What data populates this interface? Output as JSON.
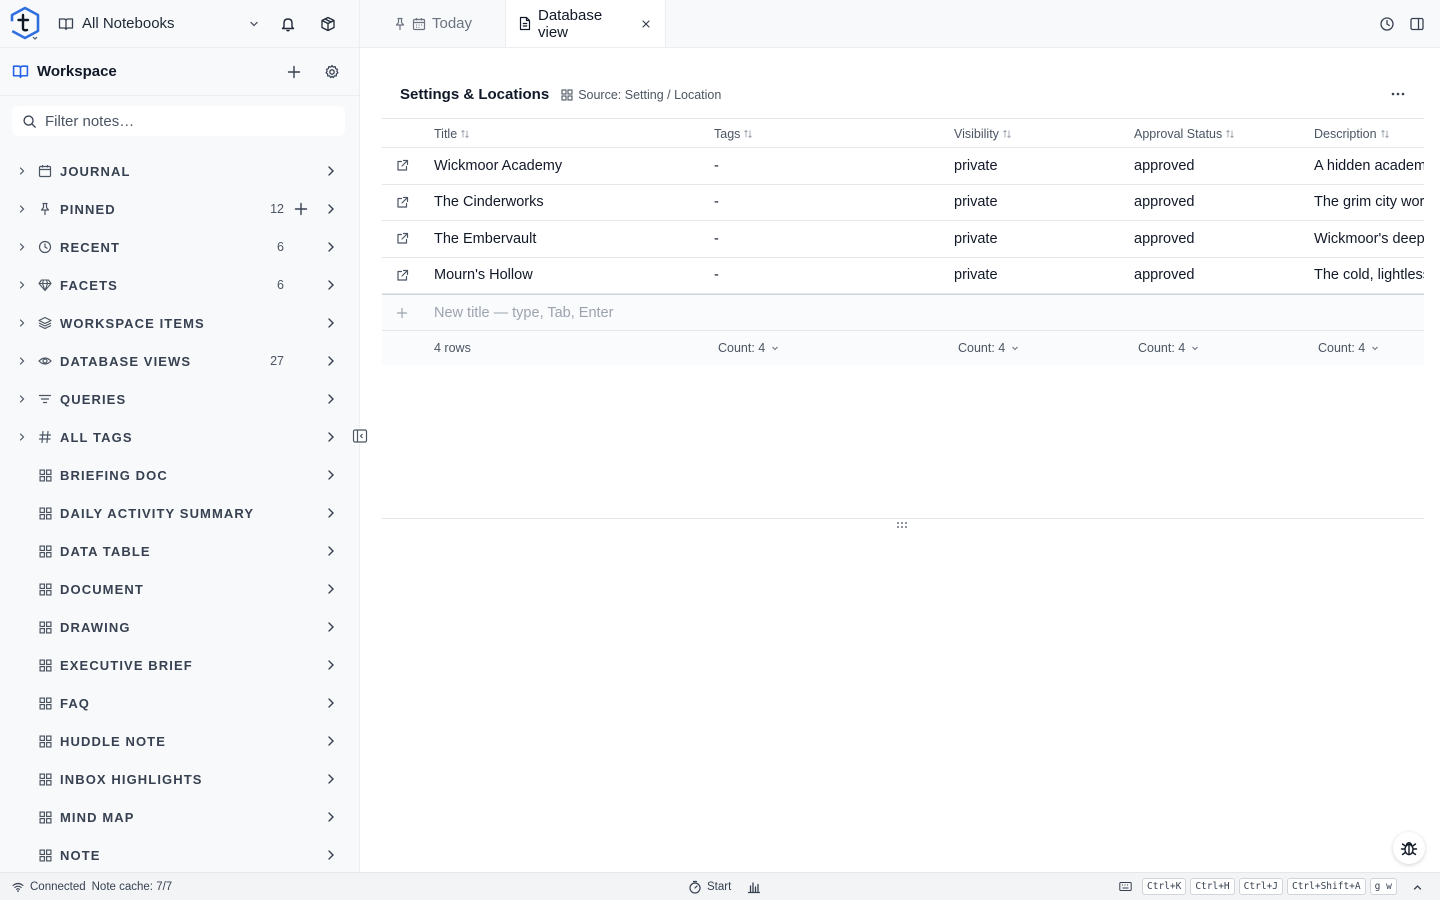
{
  "sidebar": {
    "notebook_select": "All Notebooks",
    "workspace_title": "Workspace",
    "filter_placeholder": "Filter notes…",
    "sections": [
      {
        "label": "JOURNAL",
        "icon": "calendar-icon",
        "count": "",
        "expandable": true,
        "plus": false
      },
      {
        "label": "PINNED",
        "icon": "pin-icon",
        "count": "12",
        "expandable": true,
        "plus": true
      },
      {
        "label": "RECENT",
        "icon": "clock-icon",
        "count": "6",
        "expandable": true,
        "plus": false
      },
      {
        "label": "FACETS",
        "icon": "gem-icon",
        "count": "6",
        "expandable": true,
        "plus": false
      },
      {
        "label": "WORKSPACE ITEMS",
        "icon": "layers-icon",
        "count": "",
        "expandable": true,
        "plus": false
      },
      {
        "label": "DATABASE VIEWS",
        "icon": "eye-icon",
        "count": "27",
        "expandable": true,
        "plus": false
      },
      {
        "label": "QUERIES",
        "icon": "filter-icon",
        "count": "",
        "expandable": true,
        "plus": false
      },
      {
        "label": "ALL TAGS",
        "icon": "hash-icon",
        "count": "",
        "expandable": true,
        "plus": false
      },
      {
        "label": "BRIEFING DOC",
        "icon": "grid-icon",
        "count": "",
        "expandable": false,
        "plus": false
      },
      {
        "label": "DAILY ACTIVITY SUMMARY",
        "icon": "grid-icon",
        "count": "",
        "expandable": false,
        "plus": false
      },
      {
        "label": "DATA TABLE",
        "icon": "grid-icon",
        "count": "",
        "expandable": false,
        "plus": false
      },
      {
        "label": "DOCUMENT",
        "icon": "grid-icon",
        "count": "",
        "expandable": false,
        "plus": false
      },
      {
        "label": "DRAWING",
        "icon": "grid-icon",
        "count": "",
        "expandable": false,
        "plus": false
      },
      {
        "label": "EXECUTIVE BRIEF",
        "icon": "grid-icon",
        "count": "",
        "expandable": false,
        "plus": false
      },
      {
        "label": "FAQ",
        "icon": "grid-icon",
        "count": "",
        "expandable": false,
        "plus": false
      },
      {
        "label": "HUDDLE NOTE",
        "icon": "grid-icon",
        "count": "",
        "expandable": false,
        "plus": false
      },
      {
        "label": "INBOX HIGHLIGHTS",
        "icon": "grid-icon",
        "count": "",
        "expandable": false,
        "plus": false
      },
      {
        "label": "MIND MAP",
        "icon": "grid-icon",
        "count": "",
        "expandable": false,
        "plus": false
      },
      {
        "label": "NOTE",
        "icon": "grid-icon",
        "count": "",
        "expandable": false,
        "plus": false
      }
    ]
  },
  "tabs": [
    {
      "label": "Today",
      "active": false
    },
    {
      "label": "Database view",
      "active": true
    }
  ],
  "view": {
    "title": "Settings & Locations",
    "source": "Source: Setting / Location",
    "columns": [
      "Title",
      "Tags",
      "Visibility",
      "Approval Status",
      "Description"
    ],
    "rows": [
      {
        "title": "Wickmoor Academy",
        "tags": "-",
        "visibility": "private",
        "status": "approved",
        "description": "A hidden academy"
      },
      {
        "title": "The Cinderworks",
        "tags": "-",
        "visibility": "private",
        "status": "approved",
        "description": "The grim city work"
      },
      {
        "title": "The Embervault",
        "tags": "-",
        "visibility": "private",
        "status": "approved",
        "description": "Wickmoor's deepe"
      },
      {
        "title": "Mourn's Hollow",
        "tags": "-",
        "visibility": "private",
        "status": "approved",
        "description": "The cold, lightless"
      }
    ],
    "new_row_placeholder": "New title — type, Tab, Enter",
    "footer": {
      "rows": "4 rows",
      "counts": [
        "Count: 4",
        "Count: 4",
        "Count: 4",
        "Count: 4"
      ]
    }
  },
  "statusbar": {
    "connection": "Connected",
    "cache": "Note cache: 7/7",
    "start": "Start",
    "shortcuts": [
      "Ctrl+K",
      "Ctrl+H",
      "Ctrl+J",
      "Ctrl+Shift+A",
      "g w"
    ]
  },
  "colors": {
    "accent": "#2563eb",
    "sidebar_bg": "#f8f9fa",
    "border": "#e5e7eb"
  }
}
